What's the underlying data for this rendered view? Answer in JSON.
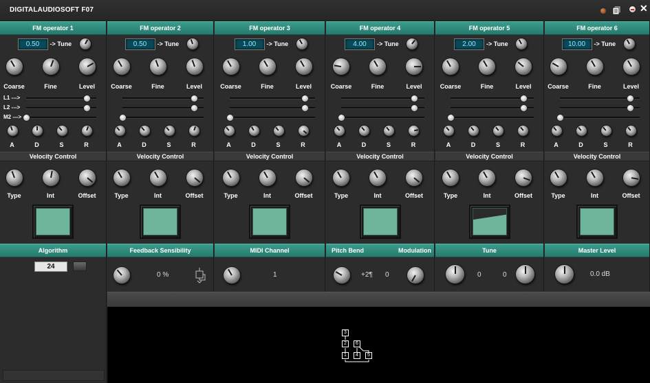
{
  "window": {
    "title": "DIGITALAUDIOSOFT  F07"
  },
  "labels": {
    "tune": "-> Tune",
    "coarse": "Coarse",
    "fine": "Fine",
    "level": "Level",
    "l1": "L1 --->",
    "l2": "L2 --->",
    "m2": "M2 --->",
    "a": "A",
    "d": "D",
    "s": "S",
    "r": "R",
    "velocity_control": "Velocity Control",
    "type": "Type",
    "int": "Int",
    "offset": "Offset"
  },
  "operators": [
    {
      "name": "FM operator 1",
      "tune_value": "0.50"
    },
    {
      "name": "FM operator 2",
      "tune_value": "0.50"
    },
    {
      "name": "FM operator 3",
      "tune_value": "1.00"
    },
    {
      "name": "FM operator 4",
      "tune_value": "4.00"
    },
    {
      "name": "FM operator 5",
      "tune_value": "2.00"
    },
    {
      "name": "FM operator 6",
      "tune_value": "10.00"
    }
  ],
  "algorithm": {
    "label": "Algorithm",
    "value": "24"
  },
  "feedback": {
    "label": "Feedback Sensibility",
    "value": "0 %"
  },
  "midi": {
    "label": "MIDI Channel",
    "value": "1"
  },
  "pitch": {
    "label": "Pitch Bend",
    "value": "+2¶",
    "mod_label": "Modulation",
    "mod_value": "0"
  },
  "tune": {
    "label": "Tune",
    "value1": "0",
    "value2": "0"
  },
  "master": {
    "label": "Master Level",
    "value": "0.0 dB"
  },
  "algorithm_diagram": {
    "nodes": [
      "3",
      "2",
      "6",
      "1",
      "4",
      "5"
    ]
  }
}
